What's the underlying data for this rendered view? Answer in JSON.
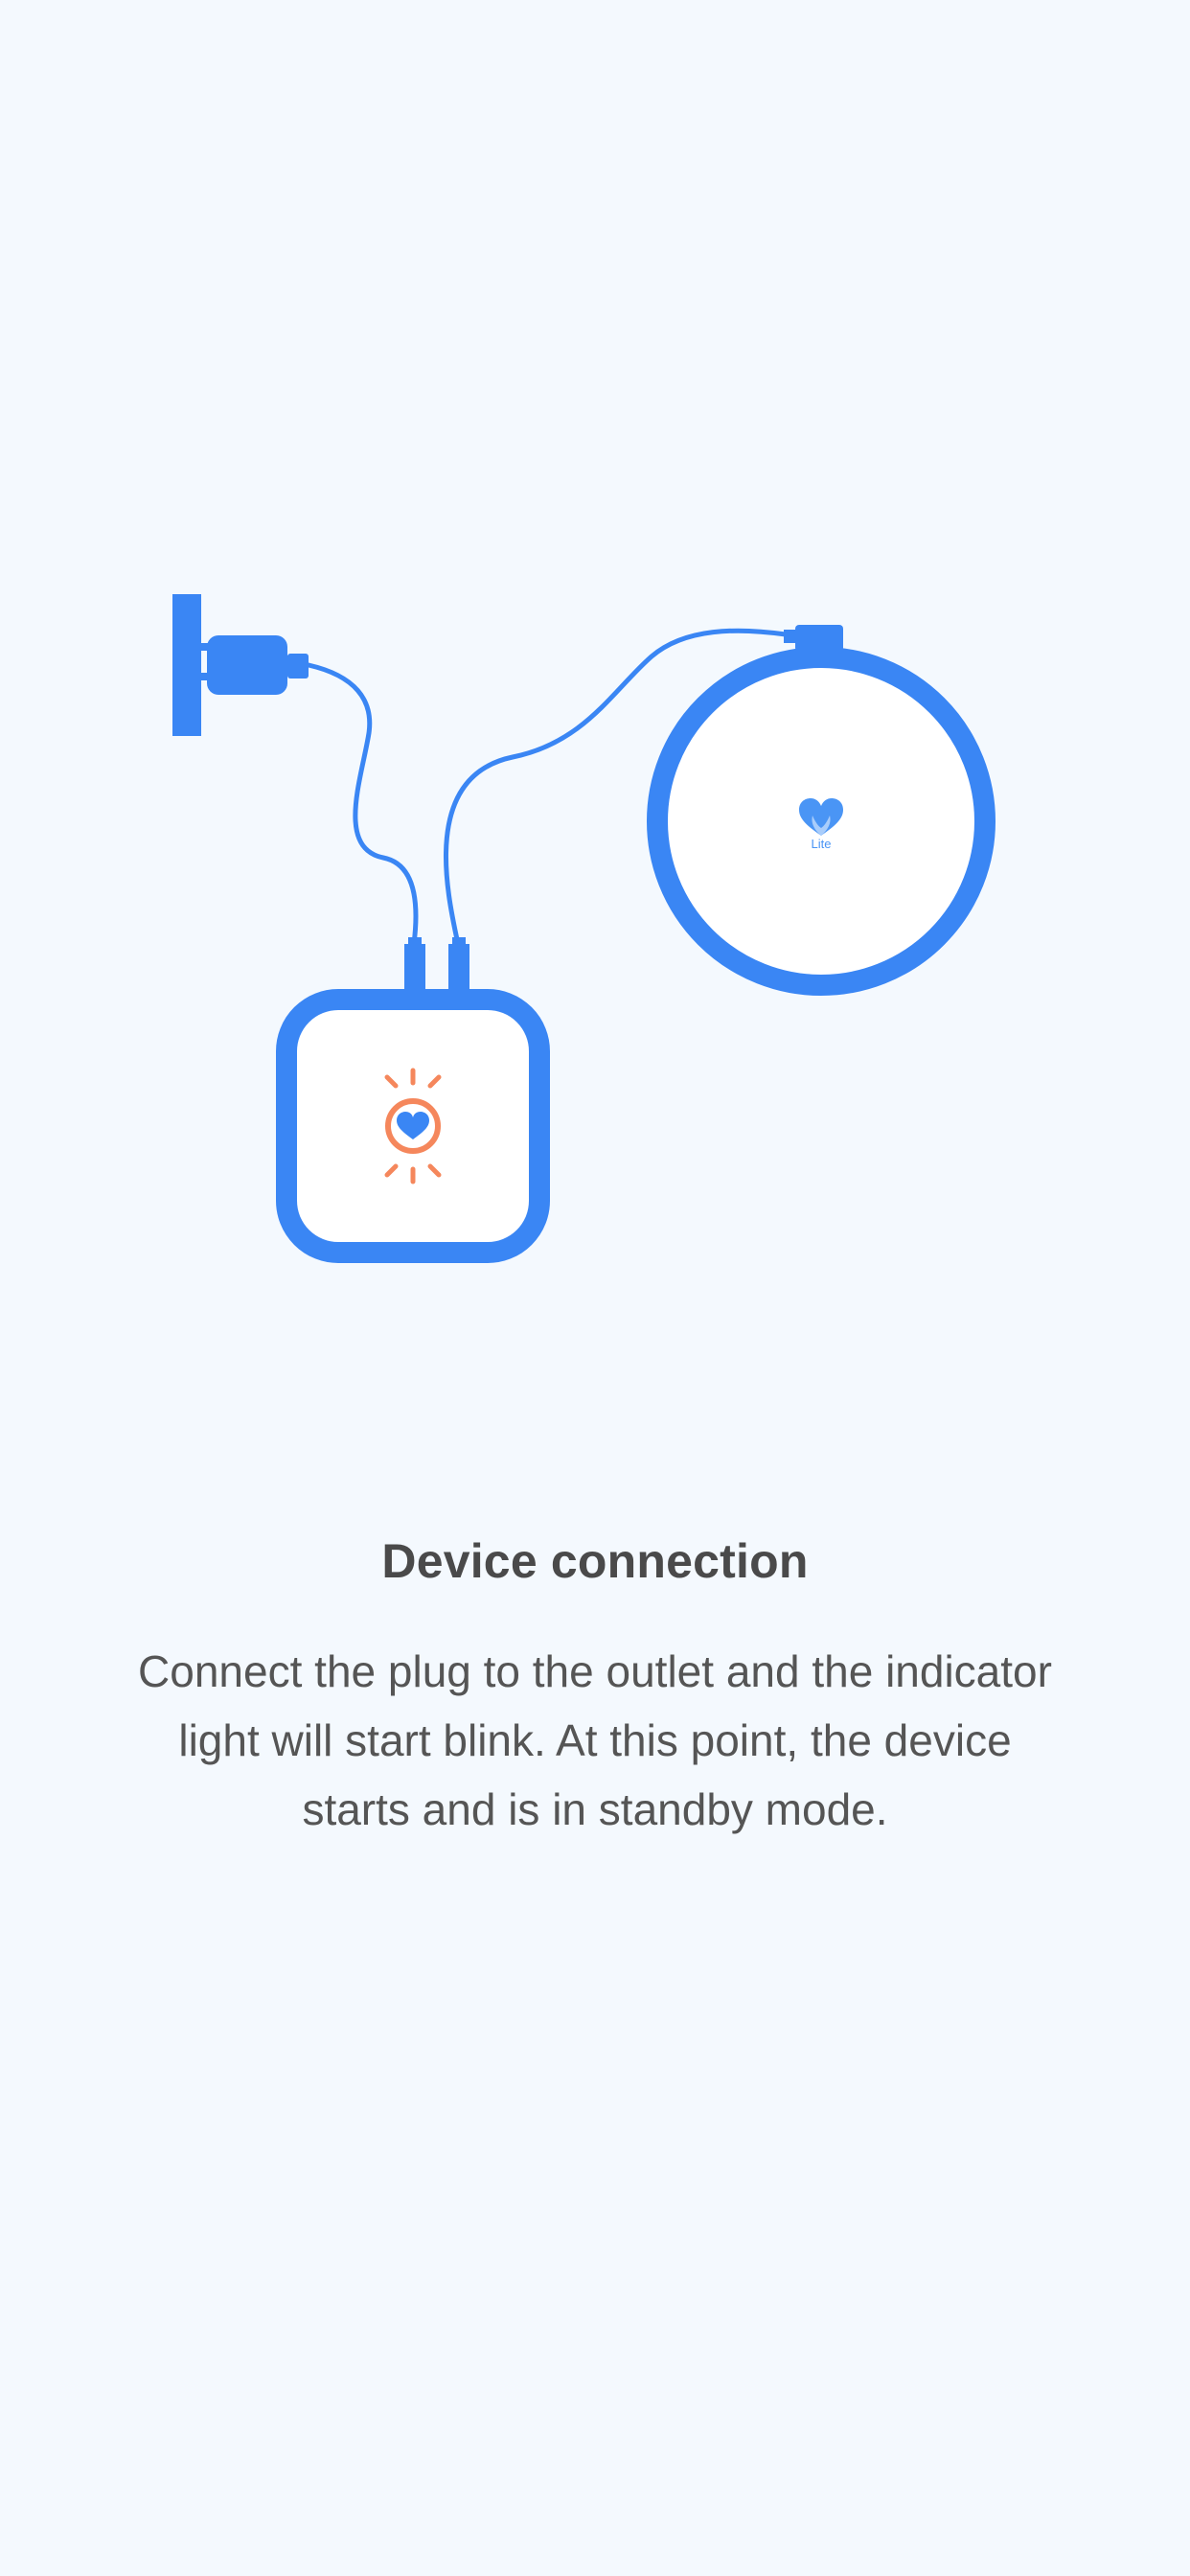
{
  "page": {
    "title": "Device connection",
    "description": "Connect the plug to the outlet and the indicator light will start blink. At this point, the device starts and is in standby mode."
  },
  "illustration": {
    "disc_logo_text": "Lite",
    "colors": {
      "device_blue": "#3a86f4",
      "indicator_orange": "#f5875c",
      "background": "#f4f9fe"
    },
    "icons": [
      "wall-outlet-icon",
      "power-adapter-icon",
      "hub-device-icon",
      "indicator-light-icon",
      "heart-logo-icon",
      "sensor-disc-icon"
    ]
  }
}
